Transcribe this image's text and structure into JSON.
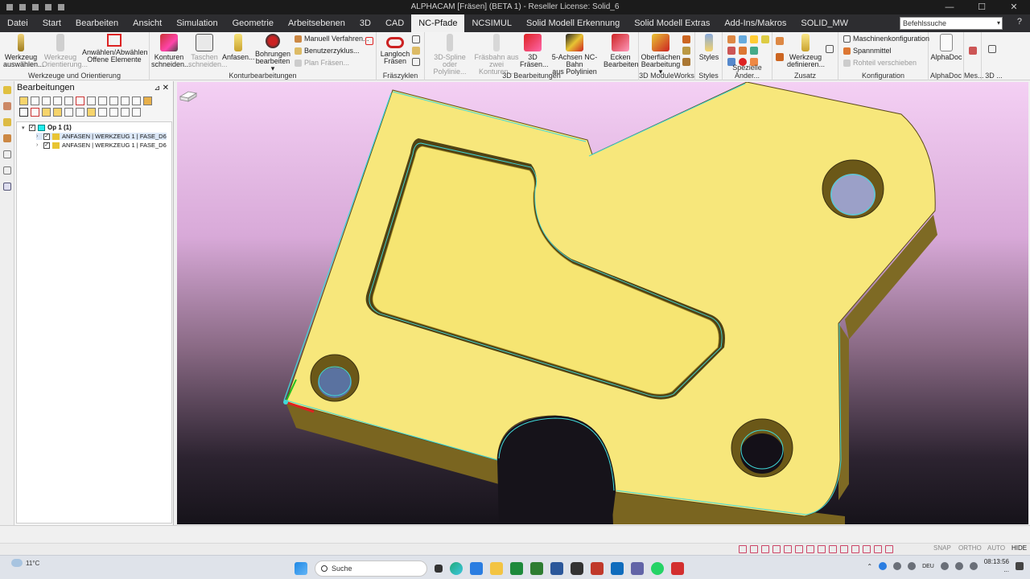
{
  "window": {
    "title": "ALPHACAM [Fräsen] (BETA 1) - Reseller License: Solid_6",
    "controls": [
      "—",
      "☐",
      "✕"
    ]
  },
  "menu": {
    "tabs": [
      "Datei",
      "Start",
      "Bearbeiten",
      "Ansicht",
      "Simulation",
      "Geometrie",
      "Arbeitsebenen",
      "3D",
      "CAD",
      "NC-Pfade",
      "NCSIMUL",
      "Solid Modell Erkennung",
      "Solid Modell Extras",
      "Add-Ins/Makros",
      "SOLID_MW"
    ],
    "active": "NC-Pfade",
    "command_search_placeholder": "Befehlssuche",
    "help": "?"
  },
  "ribbon": {
    "groups": {
      "werkzeuge": "Werkzeuge und Orientierung",
      "kontur": "Konturbearbeitungen",
      "fraes": "Fräszyklen",
      "bearb3d": "3D Bearbeitungen",
      "modulworks": "3D ModuleWorks",
      "styles": "Styles",
      "spezielle": "Spezielle Änder...",
      "zusatz": "Zusatz",
      "konfiguration": "Konfiguration",
      "alphadoc": "AlphaDoc",
      "mes": "Mes...",
      "g3d": "3D ..."
    },
    "buttons": {
      "werkzeug": "Werkzeug\nauswählen...",
      "orientierung": "Werkzeug\nOrientierung...",
      "anwaehlen": "Anwählen/Abwählen\nOffene Elemente",
      "konturen": "Konturen\nschneiden...",
      "taschen": "Taschen\nschneiden...",
      "anfasen": "Anfasen...",
      "bohrungen": "Bohrungen\nbearbeiten ▾",
      "langloch": "Langloch\nFräsen",
      "spline": "3D-Spline oder\nPolylinie...",
      "fraesbahn": "Fräsbahn aus\nzwei Konturen...",
      "fraesen3d": "3D\nFräsen...",
      "achsen5": "5-Achsen NC-Bahn\naus Polylinien",
      "ecken": "Ecken\nBearbeiten",
      "oberflaechen": "Oberflächen\nBearbeitung ▾",
      "styles": "Styles",
      "werkzeugdef": "Werkzeug\ndefinieren...",
      "alphadoc": "AlphaDoc"
    },
    "small": {
      "manuell": "Manuell Verfahren...",
      "benutzer": "Benutzerzyklus...",
      "plan": "Plan Fräsen...",
      "maschinen": "Maschinenkonfiguration",
      "spannmittel": "Spannmittel",
      "rohteil": "Rohteil verschieben"
    }
  },
  "panel": {
    "title": "Bearbeitungen",
    "pin": "⊿",
    "close": "✕",
    "tree": {
      "root": "Op 1 (1)",
      "items": [
        "ANFASEN | WERKZEUG 1 | FASE_D6",
        "ANFASEN | WERKZEUG 1 | FASE_D6"
      ]
    }
  },
  "statusbar": {
    "toggles": [
      "SNAP",
      "ORTHO",
      "AUTO",
      "HIDE"
    ]
  },
  "taskbar": {
    "weather": "11°C",
    "search": "Suche",
    "lang": "DEU",
    "time": "08:13:56",
    "date": "..."
  },
  "colors": {
    "part": "#f7e77b",
    "toolpath": "#3fd9d9",
    "ribbon_bg": "#f3f3f3",
    "tab_bar": "#2d2d30"
  }
}
